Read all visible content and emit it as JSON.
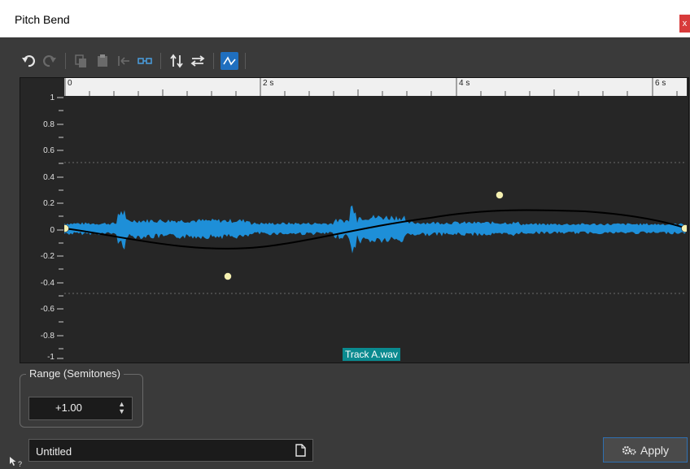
{
  "window": {
    "title": "Pitch Bend",
    "close_label": "x"
  },
  "toolbar": {
    "icons": [
      "undo-icon",
      "redo-icon",
      "copy-icon",
      "paste-icon",
      "goto-start-icon",
      "link-icon",
      "swap-vertical-icon",
      "swap-horizontal-icon",
      "curve-icon"
    ]
  },
  "ruler": {
    "labels": [
      "0",
      "2 s",
      "4 s",
      "6 s"
    ]
  },
  "yaxis": {
    "labels": [
      "1",
      "0.8",
      "0.6",
      "0.4",
      "0.2",
      "0",
      "-0.2",
      "-0.4",
      "-0.6",
      "-0.8",
      "-1"
    ]
  },
  "track": {
    "name": "Track A.wav"
  },
  "range": {
    "group_label": "Range (Semitones)",
    "value": "+1.00"
  },
  "preset": {
    "name": "Untitled"
  },
  "apply_label": "Apply",
  "colors": {
    "waveform": "#1e8fd8",
    "curve": "#000000",
    "node": "#f5f0b0",
    "accent": "#1f6fbf"
  }
}
